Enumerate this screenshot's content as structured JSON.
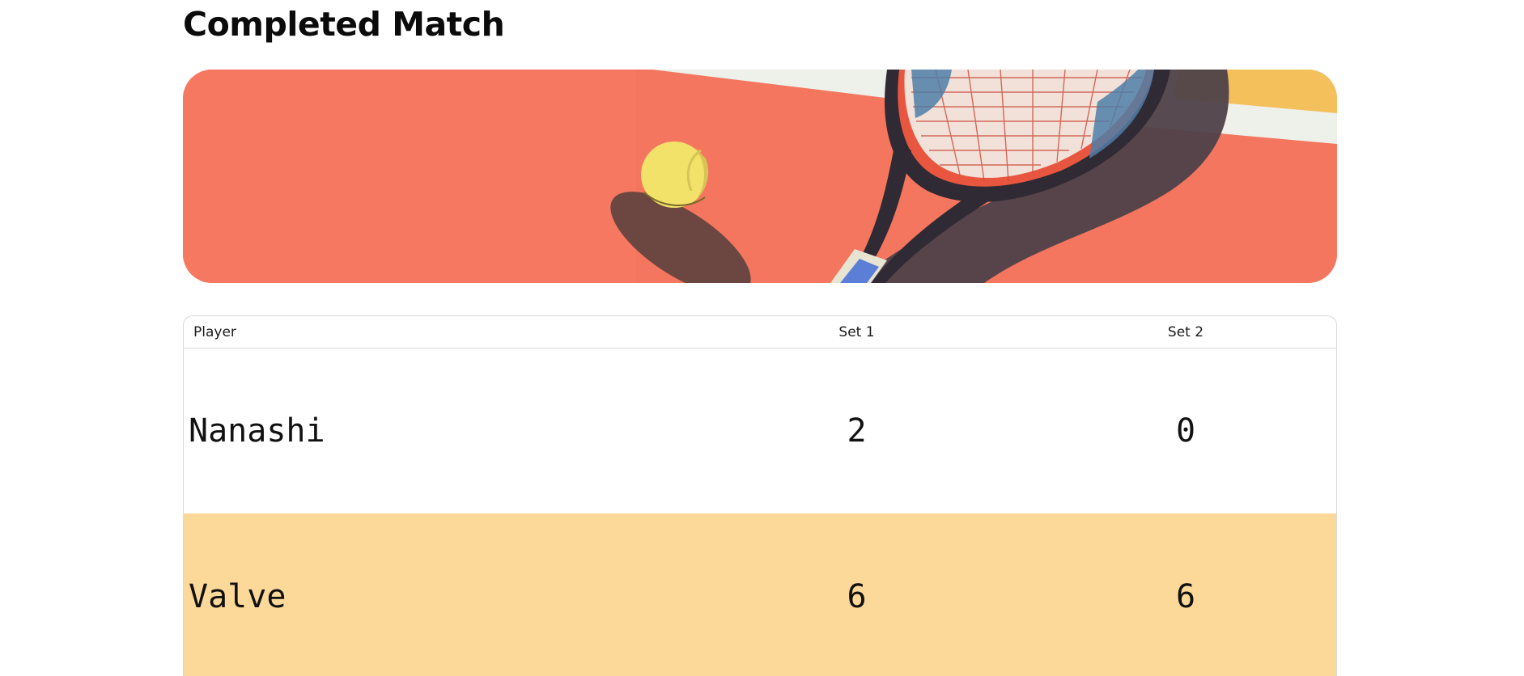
{
  "page": {
    "title": "Completed Match"
  },
  "hero": {
    "image_description_icon": "tennis-racket-ball-banner",
    "colors": {
      "court": "#f5765e",
      "ball": "#f3e26a",
      "line": "#eef0ea",
      "accent_yellow": "#f4c05b",
      "racket_shadow": "#4e4149"
    }
  },
  "scoreboard": {
    "headers": {
      "player": "Player",
      "set1": "Set 1",
      "set2": "Set 2"
    },
    "rows": [
      {
        "player": "Nanashi",
        "set1": "2",
        "set2": "0",
        "winner": false
      },
      {
        "player": "Valve",
        "set1": "6",
        "set2": "6",
        "winner": true
      }
    ],
    "winner_row_color": "#fcd899"
  }
}
